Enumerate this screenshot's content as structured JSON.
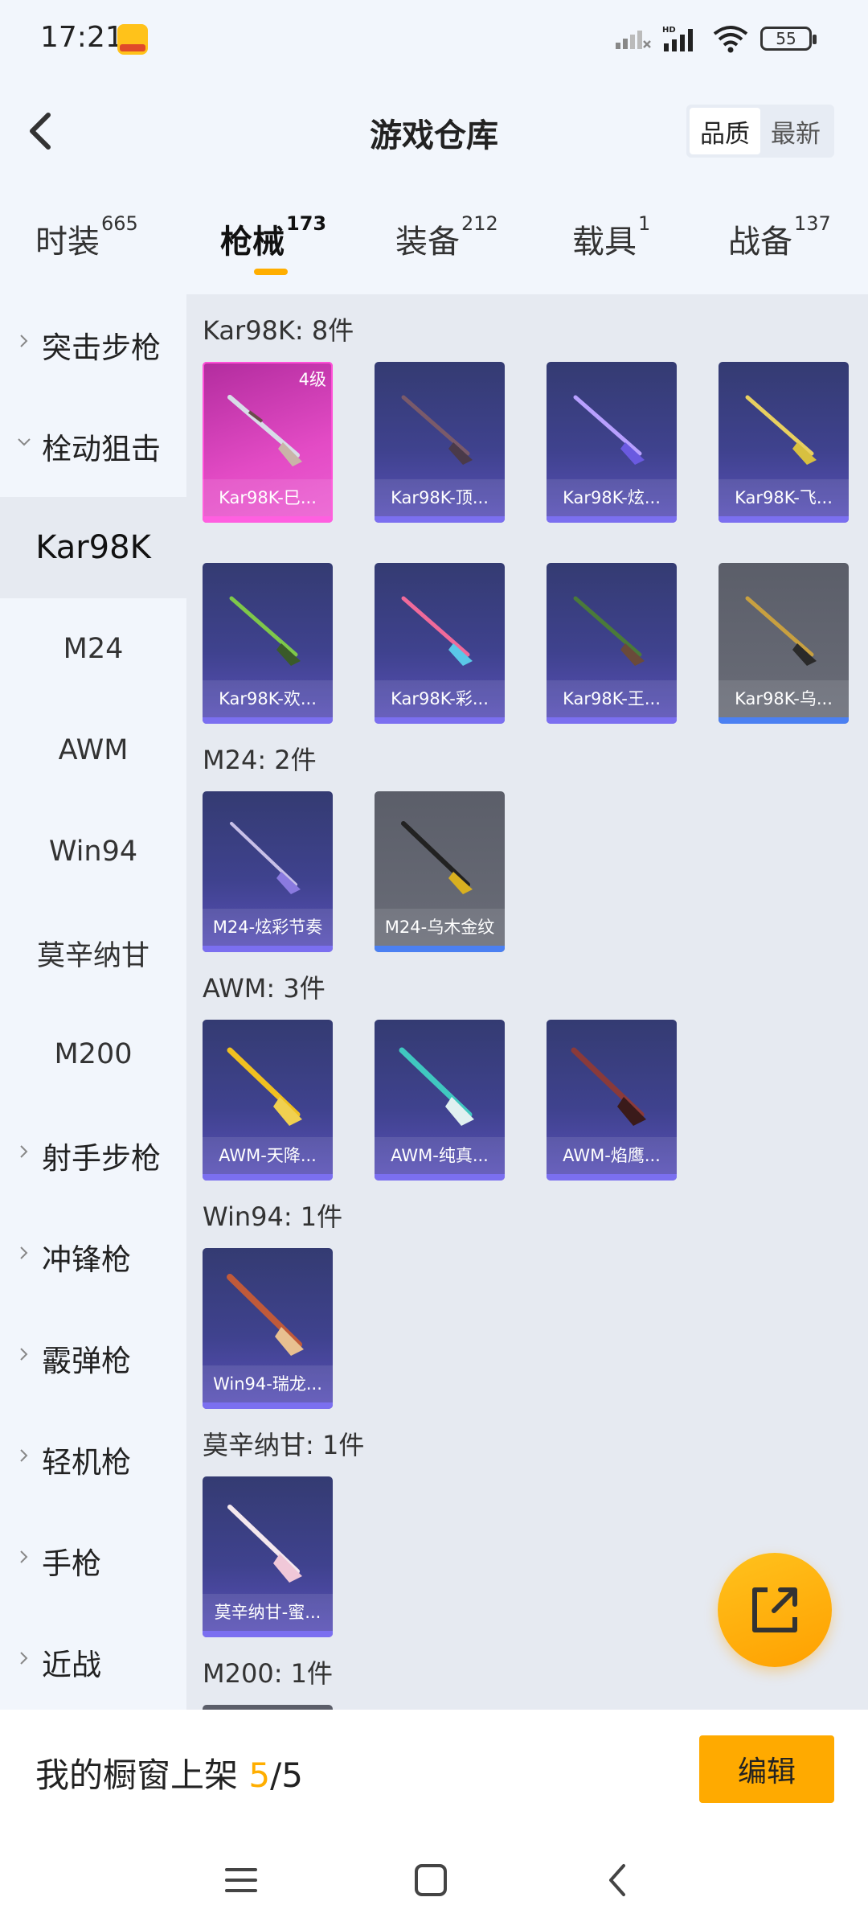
{
  "status": {
    "time": "17:21",
    "battery": "55",
    "hd": "HD"
  },
  "header": {
    "title": "游戏仓库",
    "sort": [
      "品质",
      "最新"
    ]
  },
  "tabs": [
    {
      "label": "时装",
      "count": "665"
    },
    {
      "label": "枪械",
      "count": "173"
    },
    {
      "label": "装备",
      "count": "212"
    },
    {
      "label": "载具",
      "count": "1"
    },
    {
      "label": "战备",
      "count": "137"
    }
  ],
  "sidebar": [
    "突击步枪",
    "栓动狙击",
    "Kar98K",
    "M24",
    "AWM",
    "Win94",
    "莫辛纳甘",
    "M200",
    "射手步枪",
    "冲锋枪",
    "霰弹枪",
    "轻机枪",
    "手枪",
    "近战"
  ],
  "sections": [
    {
      "title": "Kar98K: 8件",
      "items": [
        {
          "label": "Kar98K-巳...",
          "level": "4级"
        },
        {
          "label": "Kar98K-顶..."
        },
        {
          "label": "Kar98K-炫..."
        },
        {
          "label": "Kar98K-飞..."
        },
        {
          "label": "Kar98K-欢..."
        },
        {
          "label": "Kar98K-彩..."
        },
        {
          "label": "Kar98K-王..."
        },
        {
          "label": "Kar98K-乌..."
        }
      ]
    },
    {
      "title": "M24: 2件",
      "items": [
        {
          "label": "M24-炫彩节奏"
        },
        {
          "label": "M24-乌木金纹"
        }
      ]
    },
    {
      "title": "AWM: 3件",
      "items": [
        {
          "label": "AWM-天降..."
        },
        {
          "label": "AWM-纯真..."
        },
        {
          "label": "AWM-焰鹰..."
        }
      ]
    },
    {
      "title": "Win94: 1件",
      "items": [
        {
          "label": "Win94-瑞龙..."
        }
      ]
    },
    {
      "title": "莫辛纳甘: 1件",
      "items": [
        {
          "label": "莫辛纳甘-蜜..."
        }
      ]
    },
    {
      "title": "M200: 1件",
      "items": []
    }
  ],
  "bottom": {
    "prefix": "我的橱窗上架 ",
    "current": "5",
    "sep_total": "/5",
    "edit": "编辑"
  },
  "colors": {
    "accent": "#ffae00",
    "card_purple": "#3f428e",
    "card_pink": "#e34bc5",
    "card_gray": "#6a6d78"
  }
}
